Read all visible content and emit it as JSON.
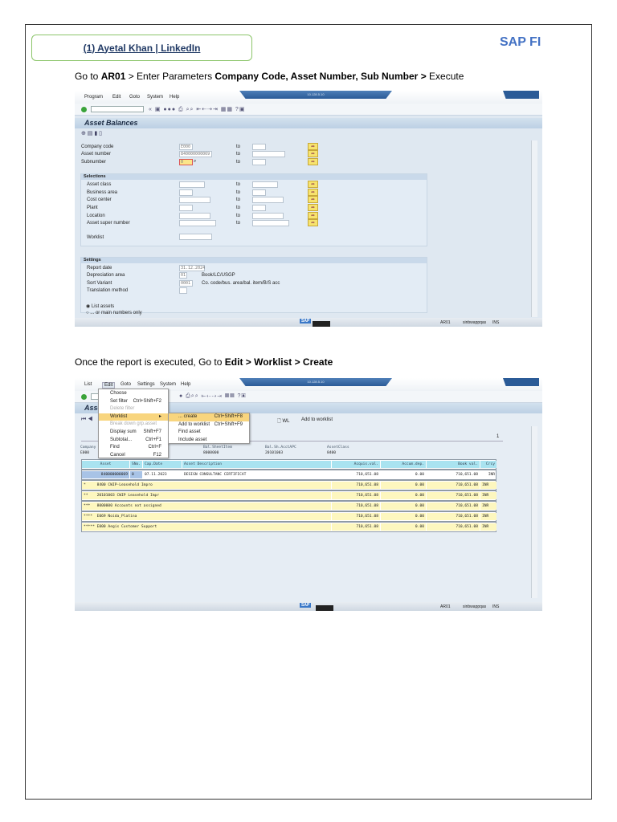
{
  "header": {
    "link_text": "(1) Ayetal Khan | LinkedIn",
    "brand": "SAP FI"
  },
  "step1": {
    "prefix": "Go to ",
    "tcode": "AR01",
    "mid": " > Enter Parameters ",
    "params": "Company Code, Asset Number, Sub Number >",
    "suffix": " Execute"
  },
  "step2": {
    "prefix": "Once the report is executed, Go to ",
    "path": "Edit > Worklist > Create"
  },
  "screen1": {
    "menu": [
      "Program",
      "Edit",
      "Goto",
      "System",
      "Help"
    ],
    "window_title": "10.128.5.10",
    "title": "Asset Balances",
    "to_label": "to",
    "fields": [
      {
        "label": "Company code",
        "value": "E000"
      },
      {
        "label": "Asset number",
        "value": "840000000069"
      },
      {
        "label": "Subnumber",
        "value": "0"
      }
    ],
    "selections_title": "Selections",
    "selections": [
      "Asset class",
      "Business area",
      "Cost center",
      "Plant",
      "Location",
      "Asset super number"
    ],
    "worklist_label": "Worklist",
    "settings_title": "Settings",
    "settings": [
      {
        "label": "Report date",
        "value": "31.12.2024",
        "desc": ""
      },
      {
        "label": "Depreciation area",
        "value": "01",
        "desc": "Book/LC/USGP"
      },
      {
        "label": "Sort Variant",
        "value": "0001",
        "desc": "Co. code/bus. area/bal. item/B/S acc"
      },
      {
        "label": "Translation method",
        "value": "",
        "desc": ""
      }
    ],
    "radio_list_assets": "List assets",
    "radio_main_numbers": "... or main numbers only",
    "status": {
      "tcode": "AR01",
      "server": "sinbwappqas",
      "mode": "INS"
    }
  },
  "screen2": {
    "menu": [
      "List",
      "Edit",
      "Goto",
      "Settings",
      "System",
      "Help"
    ],
    "window_title": "10.128.5.10",
    "title": "Asse",
    "edit_menu": [
      {
        "label": "Choose",
        "shortcut": ""
      },
      {
        "label": "Set filter",
        "shortcut": "Ctrl+Shift+F2"
      },
      {
        "label": "Delete filter",
        "shortcut": ""
      },
      {
        "label": "Worklist",
        "shortcut": "▸"
      },
      {
        "label": "Break down grp.asset",
        "shortcut": ""
      },
      {
        "label": "Display sum",
        "shortcut": "Shift+F7"
      },
      {
        "label": "Subtotal...",
        "shortcut": "Ctrl+F1"
      },
      {
        "label": "Find",
        "shortcut": "Ctrl+F"
      },
      {
        "label": "Cancel",
        "shortcut": "F12"
      }
    ],
    "worklist_submenu": [
      {
        "label": "... create",
        "shortcut": "Ctrl+Shift+F8"
      },
      {
        "label": "Add to worklist",
        "shortcut": "Ctrl+Shift+F9"
      },
      {
        "label": "Find asset",
        "shortcut": ""
      },
      {
        "label": "Include asset",
        "shortcut": ""
      }
    ],
    "toolbar_wl": "WL",
    "toolbar_add": "Add to worklist",
    "page_no": "1",
    "info": [
      {
        "label": "Company",
        "value": "E000"
      },
      {
        "label": "Bal.SheetItem",
        "value": "8000000"
      },
      {
        "label": "Bal.Sh.AcctAPC",
        "value": "20101003"
      },
      {
        "label": "AssetClass",
        "value": "8400"
      }
    ],
    "columns": [
      "Asset",
      "SNo.",
      "Cap.Date",
      "Asset Description",
      "Acquis.val.",
      "Accum.dep.",
      "Book val.",
      "Crcy"
    ],
    "detail_row": [
      "840000000069",
      "0",
      "07.11.2023",
      "DESIGN CONSULTANC CERTIFICAT",
      "710,651.08",
      "0.00",
      "710,651.08",
      "INR"
    ],
    "sum_rows": [
      {
        "text": "*     8400 CWIP-Leasehold Impro",
        "acq": "710,651.08",
        "dep": "0.00",
        "book": "710,651.08",
        "crcy": "INR"
      },
      {
        "text": "**    20101003 CWIP Leasehold Impr",
        "acq": "710,651.08",
        "dep": "0.00",
        "book": "710,651.08",
        "crcy": "INR"
      },
      {
        "text": "***   8000000 Accounts not assigned",
        "acq": "710,651.08",
        "dep": "0.00",
        "book": "710,651.08",
        "crcy": "INR"
      },
      {
        "text": "****  E069 Noida_Platina",
        "acq": "710,651.08",
        "dep": "0.00",
        "book": "710,651.08",
        "crcy": "INR"
      },
      {
        "text": "***** E000 Aegis Customer Support",
        "acq": "710,651.08",
        "dep": "0.00",
        "book": "710,651.08",
        "crcy": "INR"
      }
    ],
    "status": {
      "tcode": "AR01",
      "server": "sinbwappqas",
      "mode": "INS"
    }
  }
}
